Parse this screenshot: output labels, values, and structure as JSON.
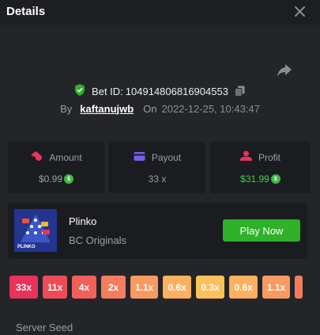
{
  "header": {
    "title": "Details"
  },
  "bet": {
    "id_label": "Bet ID:",
    "id": "104914806816904553",
    "by_label": "By",
    "user": "kaftanujwb",
    "on_label": "On",
    "datetime": "2022-12-25, 10:43:47"
  },
  "stats": {
    "amount": {
      "label": "Amount",
      "value": "$0.99"
    },
    "payout": {
      "label": "Payout",
      "value": "33 x"
    },
    "profit": {
      "label": "Profit",
      "value": "$31.99"
    }
  },
  "game": {
    "name": "Plinko",
    "provider": "BC Originals",
    "thumb_label": "PLINKO",
    "play_label": "Play Now"
  },
  "multipliers": [
    {
      "label": "33x",
      "color": "#e8345a"
    },
    {
      "label": "11x",
      "color": "#ee4b57"
    },
    {
      "label": "4x",
      "color": "#f2605a"
    },
    {
      "label": "2x",
      "color": "#f57c5f"
    },
    {
      "label": "1.1x",
      "color": "#f89a62"
    },
    {
      "label": "0.6x",
      "color": "#fbb15f"
    },
    {
      "label": "0.3x",
      "color": "#fbc15c"
    },
    {
      "label": "0.6x",
      "color": "#fbb15f"
    },
    {
      "label": "1.1x",
      "color": "#f89a62"
    },
    {
      "label": "",
      "color": "#f57c5f"
    }
  ],
  "seed": {
    "label": "Server Seed"
  },
  "colors": {
    "accent_green": "#2fb12a",
    "profit_green": "#3fd14a",
    "background": "#232529"
  }
}
